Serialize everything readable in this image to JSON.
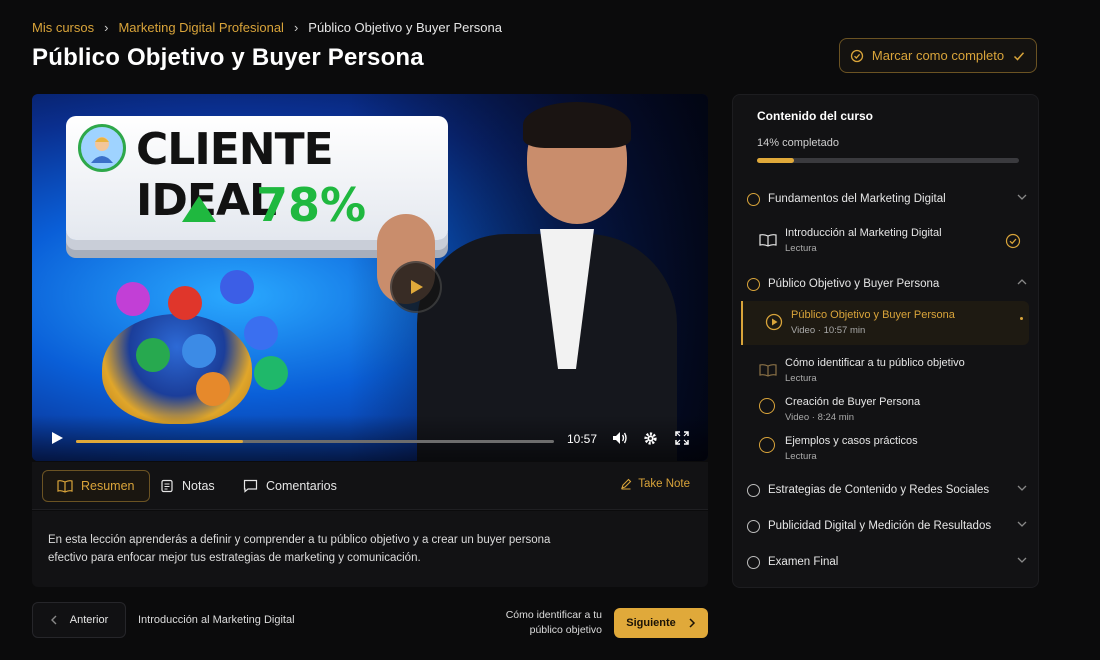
{
  "breadcrumb": {
    "items": [
      "Mis cursos",
      "Marketing Digital Profesional",
      "Público Objetivo y Buyer Persona"
    ]
  },
  "page": {
    "title": "Público Objetivo y Buyer Persona",
    "complete_label": "Marcar como completo"
  },
  "video": {
    "thumbnail_title": "CLIENTE IDEAL",
    "thumbnail_stat": "78%",
    "time": "10:57",
    "progress": 0.35
  },
  "tabs": [
    {
      "label": "Resumen",
      "icon": "book-icon",
      "active": true
    },
    {
      "label": "Notas",
      "icon": "notes-icon",
      "active": false
    },
    {
      "label": "Comentarios",
      "icon": "comment-icon",
      "active": false
    }
  ],
  "take_note_label": "Take Note",
  "summary": "En esta lección aprenderás a definir y comprender a tu público objetivo y a crear un buyer persona efectivo para enfocar mejor tus estrategias de marketing y comunicación.",
  "nav": {
    "prev_label": "Anterior",
    "prev_title": "Introducción al Marketing Digital",
    "next_title": "Cómo identificar a tu público objetivo",
    "next_label": "Siguiente"
  },
  "sidebar": {
    "title": "Contenido del curso",
    "progress_text": "14% completado",
    "progress": 0.14,
    "sections": [
      {
        "title": "Fundamentos del Marketing Digital",
        "expanded": true,
        "lessons": [
          {
            "title": "Introducción al Marketing Digital",
            "meta": "Lectura",
            "icon": "book-icon",
            "done": true
          }
        ]
      },
      {
        "title": "Público Objetivo y Buyer Persona",
        "expanded": true,
        "lessons": [
          {
            "title": "Público Objetivo y Buyer Persona",
            "meta": "Video · 10:57 min",
            "icon": "play-circle-icon",
            "active": true
          },
          {
            "title": "Cómo identificar a tu público objetivo",
            "meta": "Lectura",
            "icon": "book-icon"
          },
          {
            "title": "Creación de Buyer Persona",
            "meta": "Video · 8:24 min",
            "icon": "circle-icon"
          },
          {
            "title": "Ejemplos y casos prácticos",
            "meta": "Lectura",
            "icon": "circle-icon"
          }
        ]
      },
      {
        "title": "Estrategias de Contenido y Redes Sociales",
        "expanded": false
      },
      {
        "title": "Publicidad Digital y Medición de Resultados",
        "expanded": false
      },
      {
        "title": "Examen Final",
        "expanded": false
      }
    ]
  },
  "colors": {
    "accent": "#e0a93a",
    "background": "#0b0b0c",
    "panel": "#121214"
  }
}
